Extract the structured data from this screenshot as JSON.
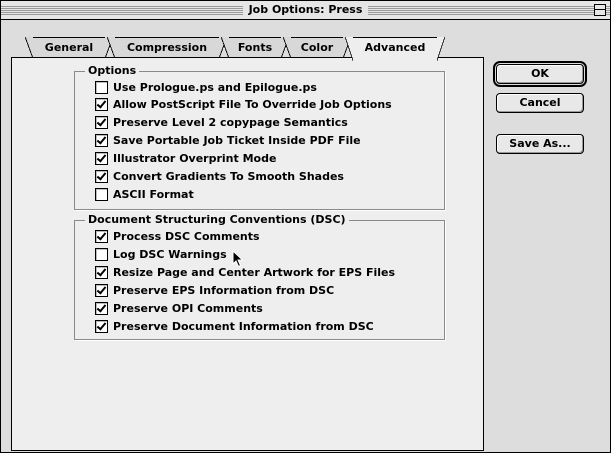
{
  "window": {
    "title": "Job Options: Press"
  },
  "tabs": [
    {
      "label": "General",
      "active": false
    },
    {
      "label": "Compression",
      "active": false
    },
    {
      "label": "Fonts",
      "active": false
    },
    {
      "label": "Color",
      "active": false
    },
    {
      "label": "Advanced",
      "active": true
    }
  ],
  "options_group": {
    "title": "Options",
    "items": [
      {
        "label": "Use Prologue.ps and Epilogue.ps",
        "checked": false
      },
      {
        "label": "Allow PostScript File To Override Job Options",
        "checked": true
      },
      {
        "label": "Preserve Level 2 copypage Semantics",
        "checked": true
      },
      {
        "label": "Save Portable Job Ticket Inside PDF File",
        "checked": true
      },
      {
        "label": "Illustrator Overprint Mode",
        "checked": true
      },
      {
        "label": "Convert Gradients To Smooth Shades",
        "checked": true
      },
      {
        "label": "ASCII Format",
        "checked": false
      }
    ]
  },
  "dsc_group": {
    "title": "Document Structuring Conventions (DSC)",
    "items": [
      {
        "label": "Process DSC Comments",
        "checked": true
      },
      {
        "label": "Log DSC Warnings",
        "checked": false
      },
      {
        "label": "Resize Page and Center Artwork for EPS Files",
        "checked": true
      },
      {
        "label": "Preserve EPS Information from DSC",
        "checked": true
      },
      {
        "label": "Preserve OPI Comments",
        "checked": true
      },
      {
        "label": "Preserve Document Information from DSC",
        "checked": true
      }
    ]
  },
  "buttons": {
    "ok": "OK",
    "cancel": "Cancel",
    "save_as": "Save As..."
  }
}
